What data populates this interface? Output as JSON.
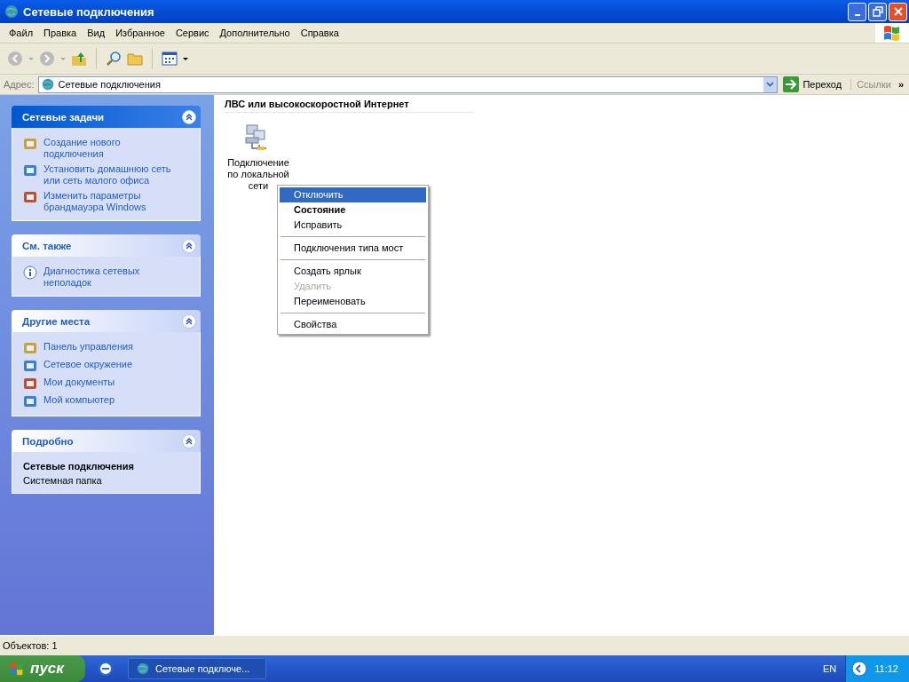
{
  "window": {
    "title": "Сетевые подключения"
  },
  "menu_bar": [
    "Файл",
    "Правка",
    "Вид",
    "Избранное",
    "Сервис",
    "Дополнительно",
    "Справка"
  ],
  "address_bar": {
    "label": "Адрес:",
    "value": "Сетевые подключения",
    "go_button": "Переход",
    "links": "Ссылки",
    "more": "»"
  },
  "sidebar": {
    "panels": [
      {
        "title": "Сетевые задачи",
        "kind": "special",
        "items": [
          "Создание нового подключения",
          "Установить домашнюю сеть или сеть малого офиса",
          "Изменить параметры брандмауэра Windows"
        ]
      },
      {
        "title": "См. также",
        "kind": "normal",
        "items": [
          "Диагностика сетевых неполадок"
        ]
      },
      {
        "title": "Другие места",
        "kind": "normal",
        "items": [
          "Панель управления",
          "Сетевое окружение",
          "Мои документы",
          "Мой компьютер"
        ]
      },
      {
        "title": "Подробно",
        "kind": "normal",
        "detail_name": "Сетевые подключения",
        "detail_type": "Системная папка"
      }
    ]
  },
  "content": {
    "group_heading": "ЛВС или высокоскоростной Интернет",
    "items": [
      {
        "label": "Подключение по локальной сети"
      }
    ]
  },
  "context_menu": [
    {
      "kind": "item",
      "label": "Отключить",
      "selected": true,
      "default": false,
      "disabled": false
    },
    {
      "kind": "item",
      "label": "Состояние",
      "selected": false,
      "default": true,
      "disabled": false
    },
    {
      "kind": "item",
      "label": "Исправить",
      "selected": false,
      "default": false,
      "disabled": false
    },
    {
      "kind": "separator"
    },
    {
      "kind": "item",
      "label": "Подключения типа мост",
      "selected": false,
      "default": false,
      "disabled": false
    },
    {
      "kind": "separator"
    },
    {
      "kind": "item",
      "label": "Создать ярлык",
      "selected": false,
      "default": false,
      "disabled": false
    },
    {
      "kind": "item",
      "label": "Удалить",
      "selected": false,
      "default": false,
      "disabled": true
    },
    {
      "kind": "item",
      "label": "Переименовать",
      "selected": false,
      "default": false,
      "disabled": false
    },
    {
      "kind": "separator"
    },
    {
      "kind": "item",
      "label": "Свойства",
      "selected": false,
      "default": false,
      "disabled": false
    }
  ],
  "status_bar": "Объектов: 1",
  "taskbar": {
    "start": "пуск",
    "task": "Сетевые подключе...",
    "language": "EN",
    "time": "11:12"
  }
}
